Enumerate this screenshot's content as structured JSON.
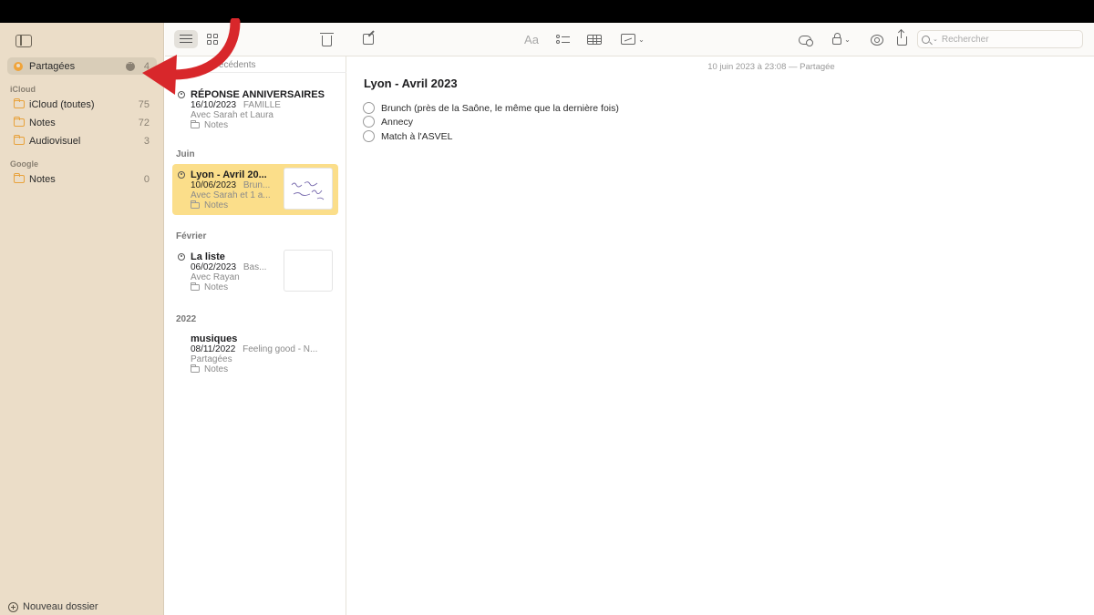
{
  "sidebar": {
    "shared": {
      "label": "Partagées",
      "count": "4"
    },
    "sections": [
      {
        "title": "iCloud",
        "items": [
          {
            "label": "iCloud (toutes)",
            "count": "75"
          },
          {
            "label": "Notes",
            "count": "72"
          },
          {
            "label": "Audiovisuel",
            "count": "3"
          }
        ]
      },
      {
        "title": "Google",
        "items": [
          {
            "label": "Notes",
            "count": "0"
          }
        ]
      }
    ],
    "new_folder_label": "Nouveau dossier"
  },
  "toolbar": {
    "format_label": "Aa",
    "search_placeholder": "Rechercher"
  },
  "note_list": {
    "header": "précédents",
    "groups": [
      {
        "label": "Juin"
      },
      {
        "label": "Février"
      },
      {
        "label": "2022"
      }
    ],
    "notes": [
      {
        "title": "RÉPONSE ANNIVERSAIRES",
        "date": "16/10/2023",
        "preview": "FAMILLE",
        "shared_with": "Avec Sarah et Laura",
        "folder": "Notes"
      },
      {
        "title": "Lyon - Avril 20...",
        "date": "10/06/2023",
        "preview": "Brun...",
        "shared_with": "Avec Sarah et 1 a...",
        "folder": "Notes"
      },
      {
        "title": "La liste",
        "date": "06/02/2023",
        "preview": "Bas...",
        "shared_with": "Avec Rayan",
        "folder": "Notes"
      },
      {
        "title": "musiques",
        "date": "08/11/2022",
        "preview": "Feeling good - N...",
        "shared_with": "Partagées",
        "folder": "Notes"
      }
    ]
  },
  "editor": {
    "meta": "10 juin 2023 à 23:08 — Partagée",
    "title": "Lyon - Avril 2023",
    "checklist": [
      "Brunch (près de la Saône, le même que la dernière fois)",
      "Annecy",
      "Match à l'ASVEL"
    ]
  },
  "colors": {
    "sidebar_bg": "#ebddc8",
    "selected_note": "#fbde8a",
    "folder_accent": "#e8a23c",
    "annotation_arrow": "#d8272b"
  }
}
